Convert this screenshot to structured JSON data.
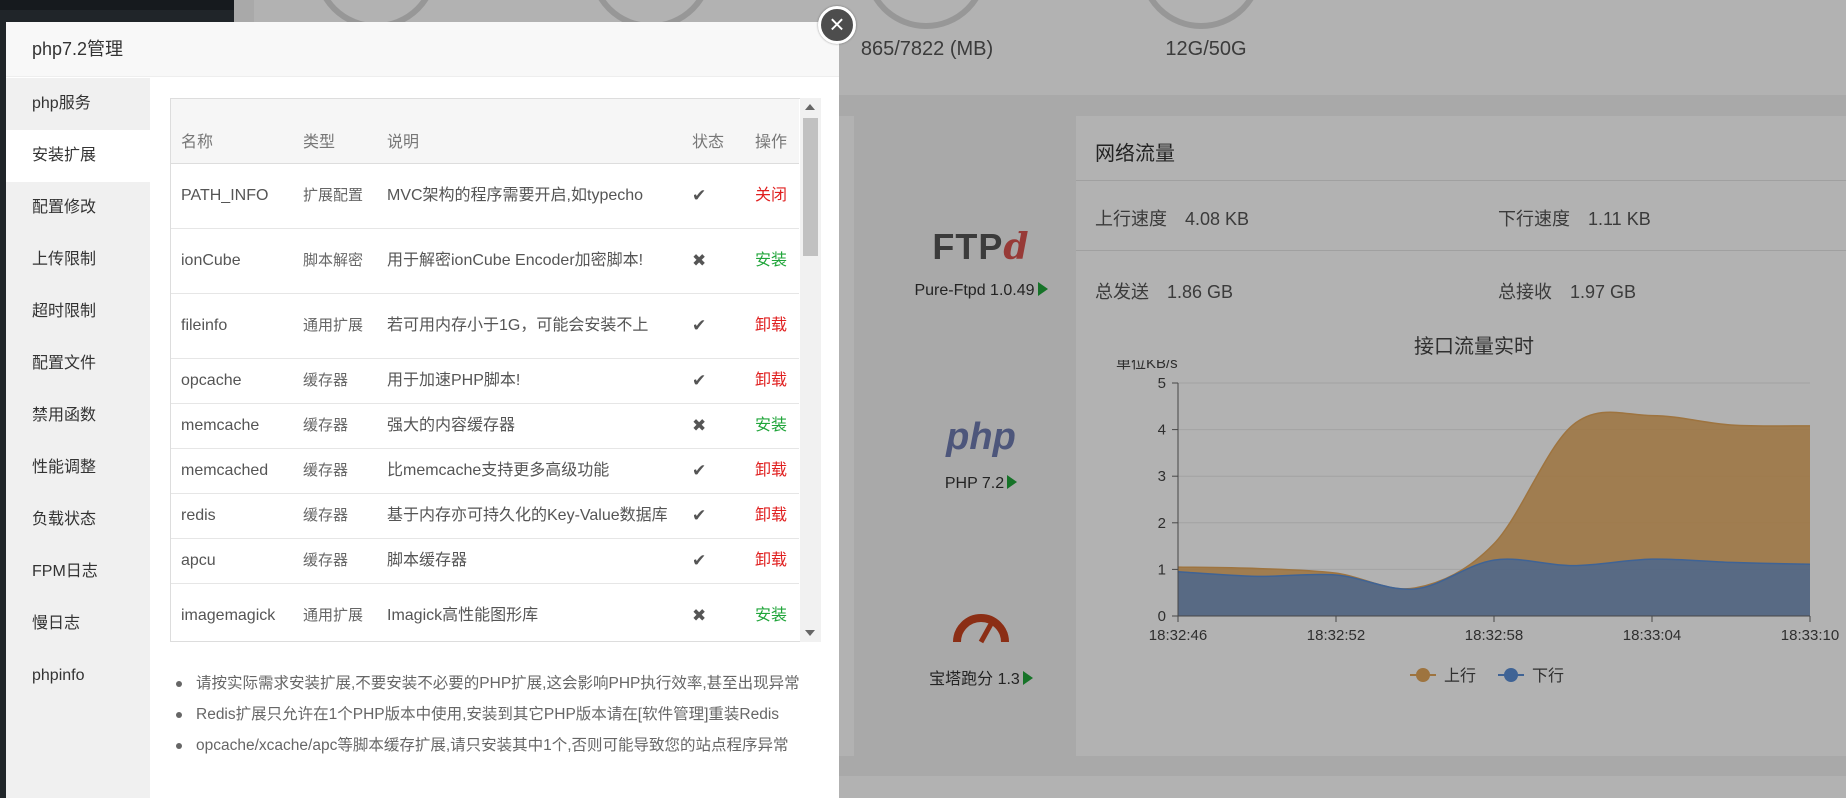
{
  "dashboard": {
    "gauges": [
      {
        "label": "865/7822 (MB)"
      },
      {
        "label": "12G/50G"
      }
    ],
    "software": [
      {
        "name": "Pure-Ftpd 1.0.49",
        "logo_text": "FTP",
        "logo_suffix": "d"
      },
      {
        "name": "PHP 7.2",
        "logo_text": "php"
      },
      {
        "name": "宝塔跑分 1.3"
      }
    ],
    "network": {
      "title": "网络流量",
      "up_speed_label": "上行速度",
      "up_speed_value": "4.08 KB",
      "down_speed_label": "下行速度",
      "down_speed_value": "1.11 KB",
      "total_sent_label": "总发送",
      "total_sent_value": "1.86 GB",
      "total_recv_label": "总接收",
      "total_recv_value": "1.97 GB"
    }
  },
  "chart_data": {
    "type": "area",
    "title": "接口流量实时",
    "ylabel": "单位KB/s",
    "xlabel": "",
    "x": [
      "18:32:46",
      "18:32:49",
      "18:32:52",
      "18:32:55",
      "18:32:58",
      "18:33:01",
      "18:33:04",
      "18:33:07",
      "18:33:10"
    ],
    "xticks": [
      "18:32:46",
      "18:32:52",
      "18:32:58",
      "18:33:04",
      "18:33:10"
    ],
    "ylim": [
      0,
      5
    ],
    "yticks": [
      0,
      1,
      2,
      3,
      4,
      5
    ],
    "grid": true,
    "legend_position": "bottom",
    "series": [
      {
        "name": "上行",
        "color": "#e2a65b",
        "values": [
          1.05,
          1.02,
          0.92,
          0.6,
          1.55,
          4.1,
          4.3,
          4.1,
          4.08
        ]
      },
      {
        "name": "下行",
        "color": "#5b8fd6",
        "values": [
          0.95,
          0.85,
          0.88,
          0.58,
          1.2,
          1.08,
          1.22,
          1.15,
          1.11
        ]
      }
    ]
  },
  "modal": {
    "title": "php7.2管理",
    "close_label": "×",
    "sidebar": [
      {
        "label": "php服务"
      },
      {
        "label": "安装扩展",
        "active": true
      },
      {
        "label": "配置修改"
      },
      {
        "label": "上传限制"
      },
      {
        "label": "超时限制"
      },
      {
        "label": "配置文件"
      },
      {
        "label": "禁用函数"
      },
      {
        "label": "性能调整"
      },
      {
        "label": "负载状态"
      },
      {
        "label": "FPM日志"
      },
      {
        "label": "慢日志"
      },
      {
        "label": "phpinfo"
      }
    ],
    "table": {
      "headers": {
        "name": "名称",
        "type": "类型",
        "desc": "说明",
        "status": "状态",
        "action": "操作"
      },
      "rows": [
        {
          "name": "PATH_INFO",
          "type": "扩展配置",
          "desc": "MVC架构的程序需要开启,如typecho",
          "status": "✔",
          "action": "关闭",
          "action_color": "red"
        },
        {
          "name": "ionCube",
          "type": "脚本解密",
          "desc": "用于解密ionCube Encoder加密脚本!",
          "status": "✖",
          "action": "安装",
          "action_color": "green"
        },
        {
          "name": "fileinfo",
          "type": "通用扩展",
          "desc": "若可用内存小于1G，可能会安装不上",
          "status": "✔",
          "action": "卸载",
          "action_color": "red"
        },
        {
          "name": "opcache",
          "type": "缓存器",
          "desc": "用于加速PHP脚本!",
          "status": "✔",
          "action": "卸载",
          "action_color": "red"
        },
        {
          "name": "memcache",
          "type": "缓存器",
          "desc": "强大的内容缓存器",
          "status": "✖",
          "action": "安装",
          "action_color": "green"
        },
        {
          "name": "memcached",
          "type": "缓存器",
          "desc": "比memcache支持更多高级功能",
          "status": "✔",
          "action": "卸载",
          "action_color": "red"
        },
        {
          "name": "redis",
          "type": "缓存器",
          "desc": "基于内存亦可持久化的Key-Value数据库",
          "status": "✔",
          "action": "卸载",
          "action_color": "red"
        },
        {
          "name": "apcu",
          "type": "缓存器",
          "desc": "脚本缓存器",
          "status": "✔",
          "action": "卸载",
          "action_color": "red"
        },
        {
          "name": "imagemagick",
          "type": "通用扩展",
          "desc": "Imagick高性能图形库",
          "status": "✖",
          "action": "安装",
          "action_color": "green"
        }
      ]
    },
    "notes": [
      "请按实际需求安装扩展,不要安装不必要的PHP扩展,这会影响PHP执行效率,甚至出现异常",
      "Redis扩展只允许在1个PHP版本中使用,安装到其它PHP版本请在[软件管理]重装Redis",
      "opcache/xcache/apc等脚本缓存扩展,请只安装其中1个,否则可能导致您的站点程序异常"
    ]
  }
}
